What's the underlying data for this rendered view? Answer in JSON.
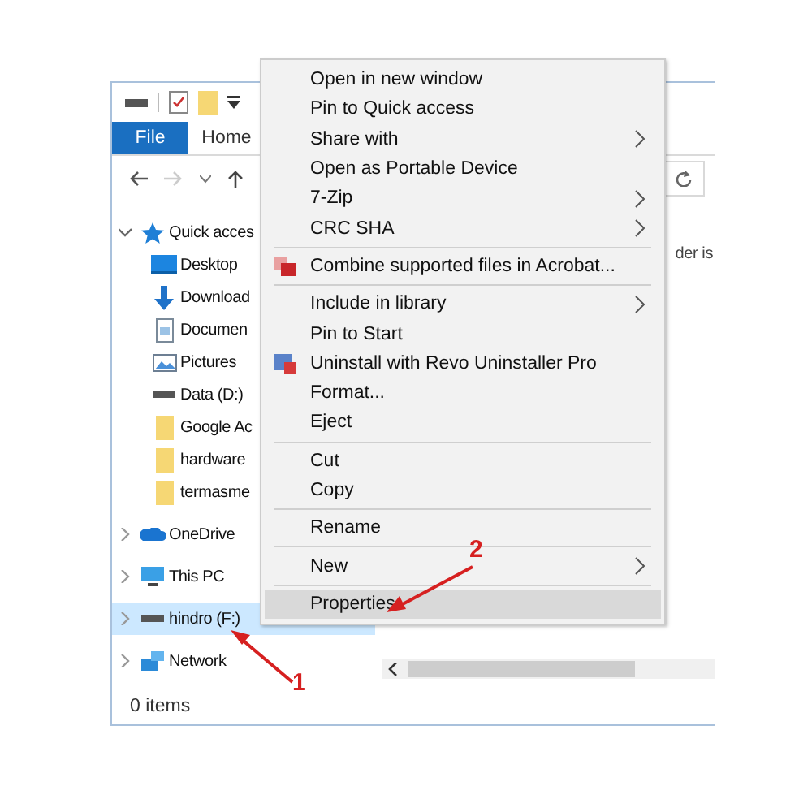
{
  "ribbon": {
    "tabs": [
      {
        "label": "File",
        "selected": true
      },
      {
        "label": "Home",
        "selected": false
      }
    ]
  },
  "sidebar": {
    "items": [
      {
        "label": "Quick acces",
        "kind": "star",
        "expanded": true,
        "selected": false,
        "children": [
          {
            "label": "Desktop",
            "kind": "desktop",
            "selected": false
          },
          {
            "label": "Download",
            "kind": "download",
            "selected": false
          },
          {
            "label": "Documen",
            "kind": "document",
            "selected": false
          },
          {
            "label": "Pictures",
            "kind": "pictures",
            "selected": false
          },
          {
            "label": "Data (D:)",
            "kind": "drive",
            "selected": false
          },
          {
            "label": "Google Ac",
            "kind": "folder",
            "selected": false
          },
          {
            "label": "hardware",
            "kind": "folder",
            "selected": false
          },
          {
            "label": "termasme",
            "kind": "folder",
            "selected": false
          }
        ]
      },
      {
        "label": "OneDrive",
        "kind": "cloud",
        "expanded": false,
        "selected": false
      },
      {
        "label": "This PC",
        "kind": "pc",
        "expanded": false,
        "selected": false
      },
      {
        "label": "hindro (F:)",
        "kind": "drive",
        "expanded": false,
        "selected": true
      },
      {
        "label": "Network",
        "kind": "network",
        "expanded": false,
        "selected": false
      }
    ]
  },
  "content_text": "der is",
  "status_bar": "0 items",
  "context_menu": {
    "items": [
      {
        "kind": "item",
        "label": "Open in new window",
        "submenu": false,
        "selected": false
      },
      {
        "kind": "item",
        "label": "Pin to Quick access",
        "submenu": false,
        "selected": false
      },
      {
        "kind": "item",
        "label": "Share with",
        "submenu": true,
        "selected": false
      },
      {
        "kind": "item",
        "label": "Open as Portable Device",
        "submenu": false,
        "selected": false
      },
      {
        "kind": "item",
        "label": "7-Zip",
        "submenu": true,
        "selected": false
      },
      {
        "kind": "item",
        "label": "CRC SHA",
        "submenu": true,
        "selected": false
      },
      {
        "kind": "separator"
      },
      {
        "kind": "acrobat",
        "label": "Combine supported files in Acrobat...",
        "submenu": false,
        "selected": false
      },
      {
        "kind": "separator"
      },
      {
        "kind": "item",
        "label": "Include in library",
        "submenu": true,
        "selected": false
      },
      {
        "kind": "item",
        "label": "Pin to Start",
        "submenu": false,
        "selected": false
      },
      {
        "kind": "revo",
        "label": "Uninstall with Revo Uninstaller Pro",
        "submenu": false,
        "selected": false
      },
      {
        "kind": "item",
        "label": "Format...",
        "submenu": false,
        "selected": false
      },
      {
        "kind": "item",
        "label": "Eject",
        "submenu": false,
        "selected": false
      },
      {
        "kind": "separator"
      },
      {
        "kind": "item",
        "label": "Cut",
        "submenu": false,
        "selected": false
      },
      {
        "kind": "item",
        "label": "Copy",
        "submenu": false,
        "selected": false
      },
      {
        "kind": "separator"
      },
      {
        "kind": "item",
        "label": "Rename",
        "submenu": false,
        "selected": false
      },
      {
        "kind": "separator"
      },
      {
        "kind": "item",
        "label": "New",
        "submenu": true,
        "selected": false
      },
      {
        "kind": "separator"
      },
      {
        "kind": "item",
        "label": "Properties",
        "submenu": false,
        "selected": true
      }
    ]
  },
  "annotations": [
    {
      "label": "1"
    },
    {
      "label": "2"
    }
  ]
}
